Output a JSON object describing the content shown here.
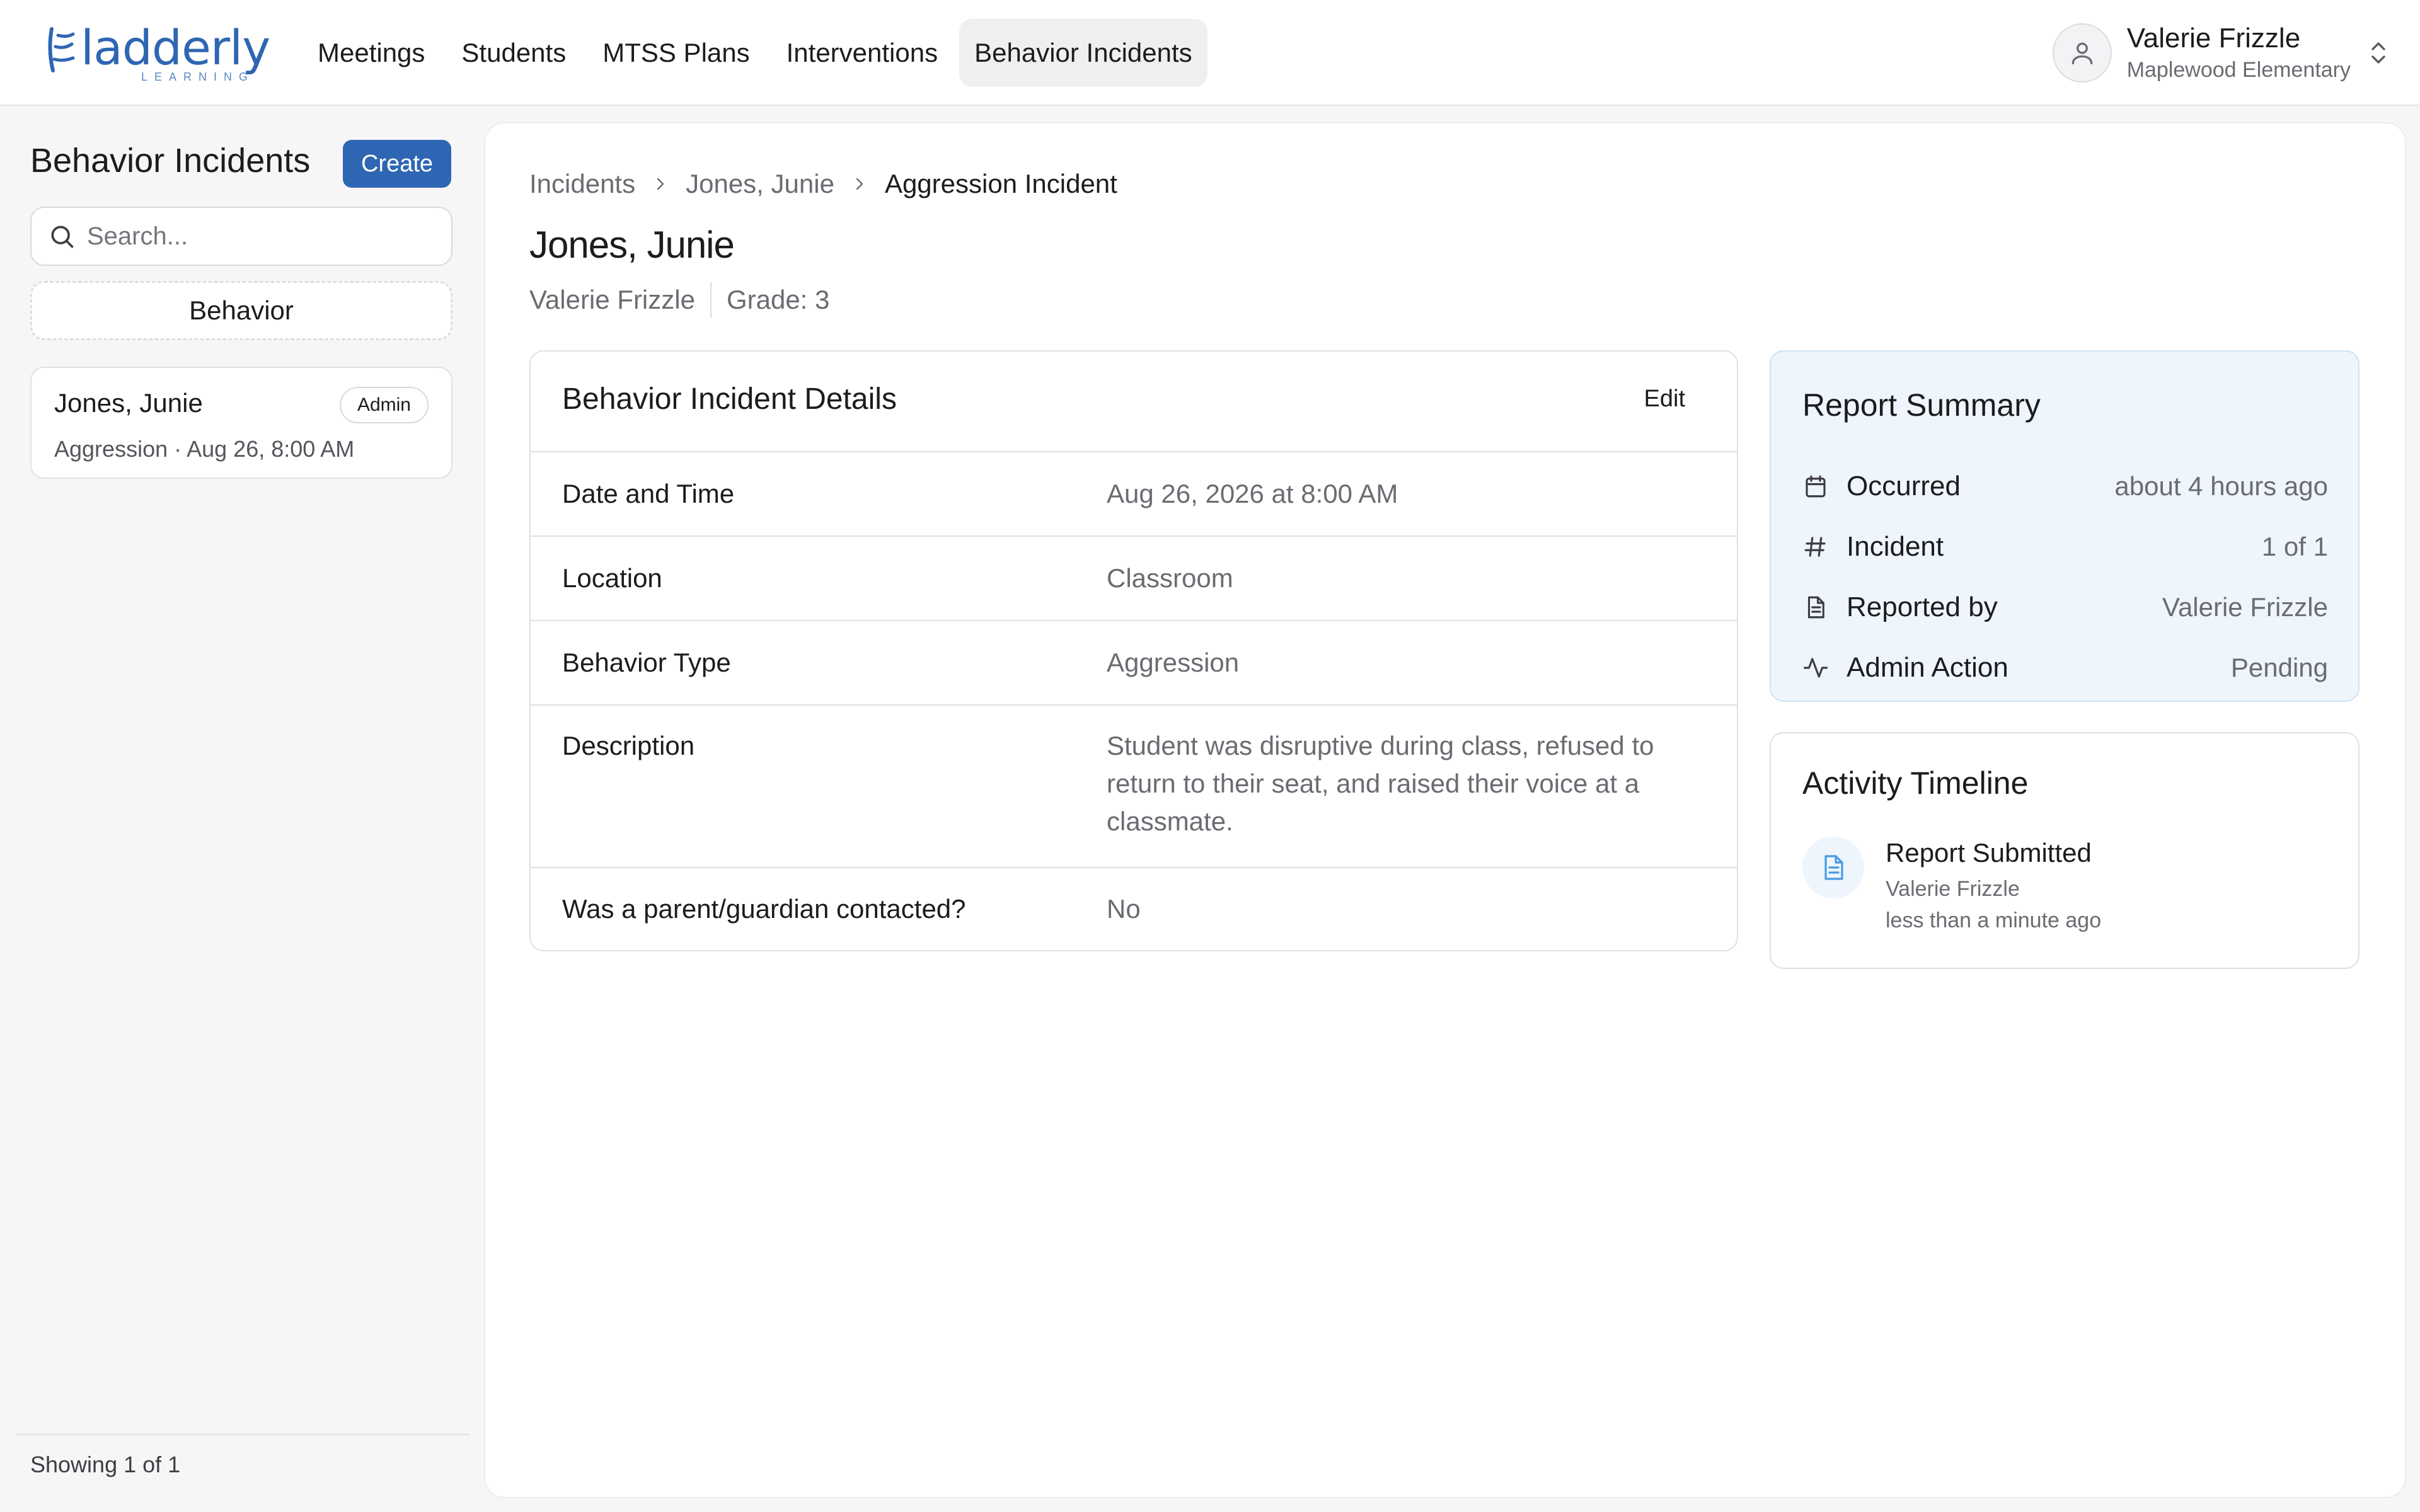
{
  "brand": {
    "name": "ladderly",
    "tagline": "LEARNING",
    "color": "#2f66b3"
  },
  "nav": {
    "items": [
      {
        "label": "Meetings"
      },
      {
        "label": "Students"
      },
      {
        "label": "MTSS Plans"
      },
      {
        "label": "Interventions"
      },
      {
        "label": "Behavior Incidents",
        "active": true
      }
    ]
  },
  "user": {
    "name": "Valerie Frizzle",
    "school": "Maplewood Elementary"
  },
  "sidebar": {
    "title": "Behavior Incidents",
    "create_label": "Create",
    "search_placeholder": "Search...",
    "filter_label": "Behavior",
    "items": [
      {
        "name": "Jones, Junie",
        "badge": "Admin",
        "subtitle": "Aggression · Aug 26, 8:00 AM"
      }
    ],
    "footer": "Showing 1 of 1"
  },
  "breadcrumb": {
    "root": "Incidents",
    "student": "Jones, Junie",
    "current": "Aggression Incident"
  },
  "student": {
    "name": "Jones, Junie",
    "teacher": "Valerie Frizzle",
    "grade": "Grade: 3"
  },
  "details": {
    "title": "Behavior Incident Details",
    "edit_label": "Edit",
    "rows": [
      {
        "label": "Date and Time",
        "value": "Aug 26, 2026 at 8:00 AM"
      },
      {
        "label": "Location",
        "value": "Classroom"
      },
      {
        "label": "Behavior Type",
        "value": "Aggression"
      },
      {
        "label": "Description",
        "value": "Student was disruptive during class, refused to return to their seat, and raised their voice at a classmate."
      },
      {
        "label": "Was a parent/guardian contacted?",
        "value": "No"
      }
    ]
  },
  "summary": {
    "title": "Report Summary",
    "rows": [
      {
        "icon": "calendar-icon",
        "label": "Occurred",
        "value": "about 4 hours ago"
      },
      {
        "icon": "hash-icon",
        "label": "Incident",
        "value": "1 of 1"
      },
      {
        "icon": "document-icon",
        "label": "Reported by",
        "value": "Valerie Frizzle"
      },
      {
        "icon": "activity-icon",
        "label": "Admin Action",
        "value": "Pending"
      }
    ]
  },
  "timeline": {
    "title": "Activity Timeline",
    "events": [
      {
        "icon": "document-icon",
        "title": "Report Submitted",
        "who": "Valerie Frizzle",
        "when": "less than a minute ago"
      }
    ]
  }
}
